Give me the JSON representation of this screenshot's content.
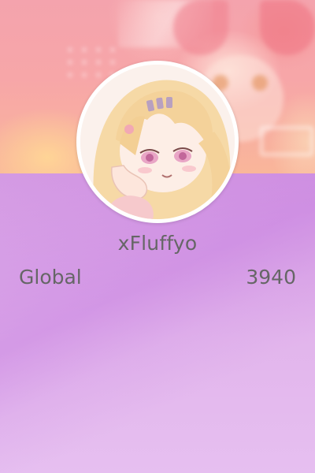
{
  "profile": {
    "username": "xFluffyo",
    "avatar_alt": "profile-avatar",
    "stats": {
      "label": "Global",
      "value": "3940"
    }
  },
  "colors": {
    "text": "#666666",
    "banner": "#f4a3ad",
    "background": "#d9a6e6",
    "avatar_ring": "#ffffff"
  }
}
